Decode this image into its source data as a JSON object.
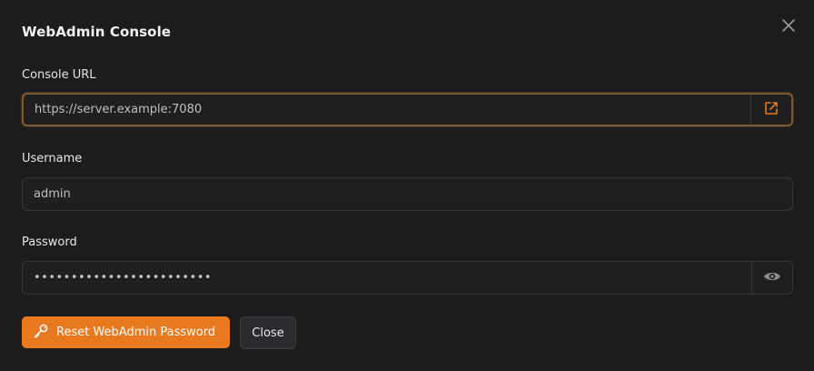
{
  "dialog": {
    "title": "WebAdmin Console",
    "close_icon": "close-icon"
  },
  "fields": {
    "console_url": {
      "label": "Console URL",
      "value": "https://server.example:7080",
      "addon_icon": "external-link-icon"
    },
    "username": {
      "label": "Username",
      "value": "admin"
    },
    "password": {
      "label": "Password",
      "value": "••••••••••••••••••••••••",
      "addon_icon": "eye-icon"
    }
  },
  "actions": {
    "reset_label": "Reset WebAdmin Password",
    "reset_icon": "key-icon",
    "close_label": "Close"
  },
  "colors": {
    "accent": "#e8791e",
    "focus_border": "#7c5a30",
    "background": "#1c1c1d"
  }
}
